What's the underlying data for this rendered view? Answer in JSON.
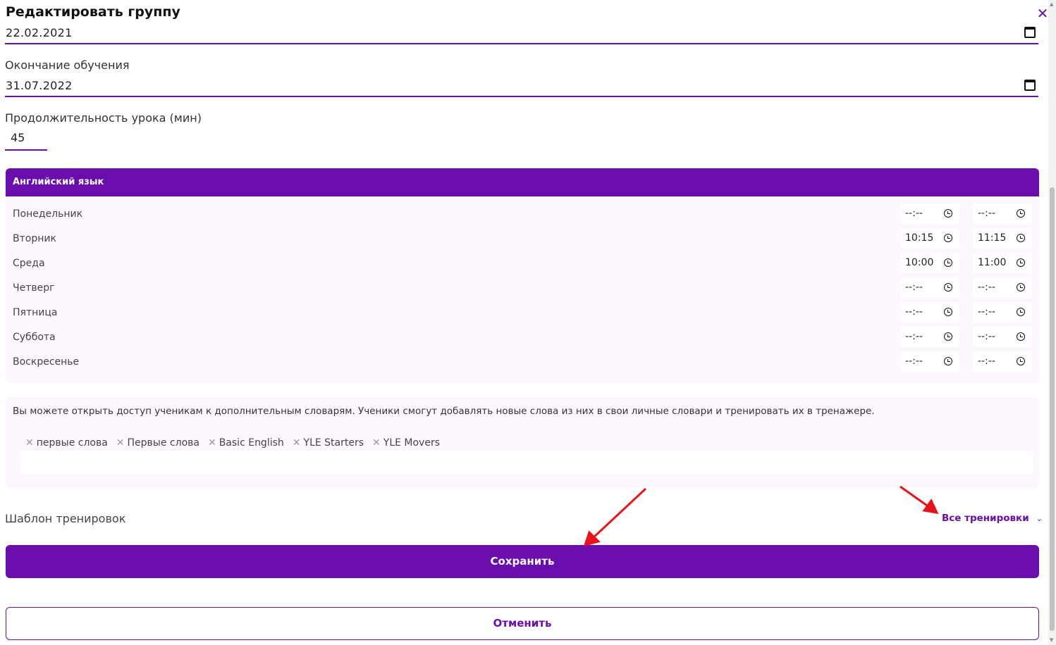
{
  "dialog": {
    "title": "Редактировать группу",
    "close_icon": "close-icon"
  },
  "start_date": {
    "value": "22.02.2021"
  },
  "end_date": {
    "label": "Окончание обучения",
    "value": "31.07.2022"
  },
  "duration": {
    "label": "Продолжительность урока (мин)",
    "value": "45"
  },
  "schedule": {
    "title": "Английский язык",
    "rows": [
      {
        "day": "Понедельник",
        "start": "--:--",
        "end": "--:--"
      },
      {
        "day": "Вторник",
        "start": "10:15",
        "end": "11:15"
      },
      {
        "day": "Среда",
        "start": "10:00",
        "end": "11:00"
      },
      {
        "day": "Четверг",
        "start": "--:--",
        "end": "--:--"
      },
      {
        "day": "Пятница",
        "start": "--:--",
        "end": "--:--"
      },
      {
        "day": "Суббота",
        "start": "--:--",
        "end": "--:--"
      },
      {
        "day": "Воскресенье",
        "start": "--:--",
        "end": "--:--"
      }
    ]
  },
  "dictionaries": {
    "info": "Вы можете открыть доступ ученикам к дополнительным словарям. Ученики смогут добавлять новые слова из них в свои личные словари и тренировать их в тренажере.",
    "chips": [
      "первые слова",
      "Первые слова",
      "Basic English",
      "YLE Starters",
      "YLE Movers"
    ]
  },
  "template": {
    "label": "Шаблон тренировок",
    "selected": "Все тренировки"
  },
  "buttons": {
    "save": "Сохранить",
    "cancel": "Отменить"
  },
  "colors": {
    "accent": "#6a0dad",
    "panel_bg": "#fcf6fd",
    "annotation_arrow": "#e8141b"
  }
}
